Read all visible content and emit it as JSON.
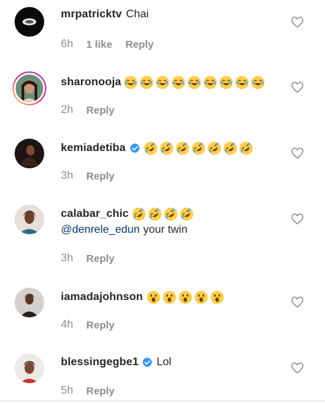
{
  "comments": [
    {
      "username": "mrpatricktv",
      "text": "Chai",
      "time": "6h",
      "likes": "1 like",
      "reply": "Reply"
    },
    {
      "username": "sharonooja",
      "emoji_text": "😂😂😂😂😂😂😂😂😂",
      "time": "2h",
      "reply": "Reply"
    },
    {
      "username": "kemiadetiba",
      "emoji_text": "🤣🤣🤣🤣🤣🤣🤣",
      "time": "3h",
      "reply": "Reply"
    },
    {
      "username": "calabar_chic",
      "emoji_text": "🤣🤣🤣🤣",
      "mention": "@denrele_edun",
      "text": "your twin",
      "time": "3h",
      "reply": "Reply"
    },
    {
      "username": "iamadajohnson",
      "emoji_text": "😮😮😮😮😮",
      "time": "4h",
      "reply": "Reply"
    },
    {
      "username": "blessingegbe1",
      "text": "Lol",
      "time": "5h",
      "reply": "Reply"
    }
  ],
  "colors": {
    "verified": "#3897f0",
    "story_ring": "#d6249f",
    "meta": "#8e8e8e",
    "mention": "#00376b"
  },
  "icons": {
    "like": "heart-outline-icon",
    "verified": "verified-badge-icon"
  }
}
